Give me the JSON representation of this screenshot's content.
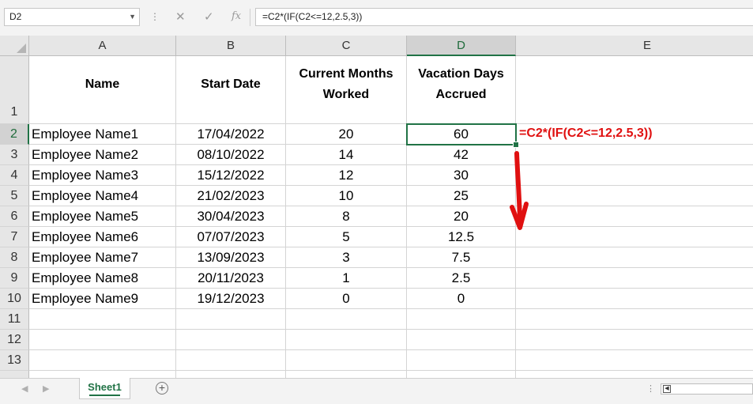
{
  "formula_bar": {
    "name_box": "D2",
    "formula": "=C2*(IF(C2<=12,2.5,3))",
    "icons": [
      "more-dots-icon",
      "cancel-x-icon",
      "enter-check-icon",
      "insert-function-icon"
    ],
    "cancel_glyph": "✕",
    "enter_glyph": "✓",
    "fx_glyph": "fx"
  },
  "columns": [
    {
      "letter": "A"
    },
    {
      "letter": "B"
    },
    {
      "letter": "C"
    },
    {
      "letter": "D"
    },
    {
      "letter": "E"
    }
  ],
  "rows": [
    "1",
    "2",
    "3",
    "4",
    "5",
    "6",
    "7",
    "8",
    "9",
    "10",
    "11",
    "12",
    "13"
  ],
  "headers": {
    "name": "Name",
    "start_date": "Start Date",
    "months_line1": "Current Months",
    "months_line2": "Worked",
    "vacation_line1": "Vacation Days",
    "vacation_line2": "Accrued"
  },
  "data_rows": [
    {
      "name": "Employee Name1",
      "start": "17/04/2022",
      "months": "20",
      "days": "60"
    },
    {
      "name": "Employee Name2",
      "start": "08/10/2022",
      "months": "14",
      "days": "42"
    },
    {
      "name": "Employee Name3",
      "start": "15/12/2022",
      "months": "12",
      "days": "30"
    },
    {
      "name": "Employee Name4",
      "start": "21/02/2023",
      "months": "10",
      "days": "25"
    },
    {
      "name": "Employee Name5",
      "start": "30/04/2023",
      "months": "8",
      "days": "20"
    },
    {
      "name": "Employee Name6",
      "start": "07/07/2023",
      "months": "5",
      "days": "12.5"
    },
    {
      "name": "Employee Name7",
      "start": "13/09/2023",
      "months": "3",
      "days": "7.5"
    },
    {
      "name": "Employee Name8",
      "start": "20/11/2023",
      "months": "1",
      "days": "2.5"
    },
    {
      "name": "Employee Name9",
      "start": "19/12/2023",
      "months": "0",
      "days": "0"
    }
  ],
  "annotation": {
    "text": "=C2*(IF(C2<=12,2.5,3))",
    "color": "#e01010"
  },
  "sheet_tabs": [
    {
      "label": "Sheet1",
      "active": true
    }
  ],
  "accent_color": "#217346"
}
